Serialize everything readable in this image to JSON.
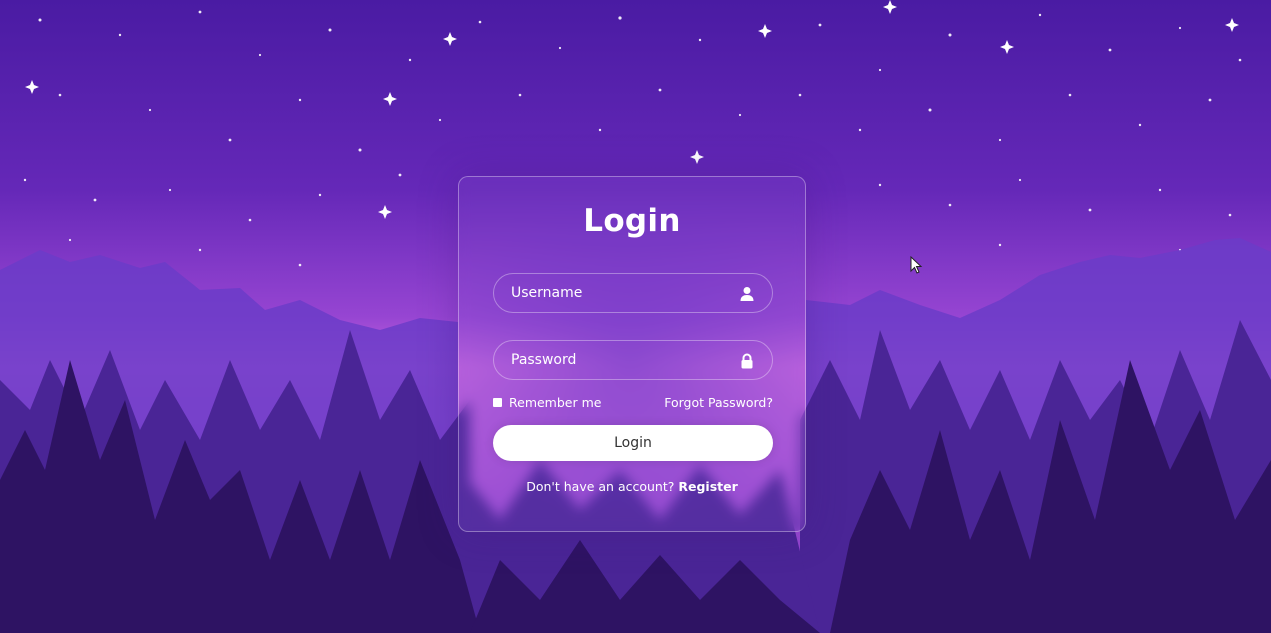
{
  "login_form": {
    "title": "Login",
    "username": {
      "placeholder": "Username",
      "value": "",
      "icon": "user-icon"
    },
    "password": {
      "placeholder": "Password",
      "value": "",
      "icon": "lock-icon"
    },
    "remember_label": "Remember me",
    "remember_checked": false,
    "forgot_label": "Forgot Password?",
    "submit_label": "Login",
    "register_prompt": "Don't have an account?",
    "register_label": "Register"
  },
  "colors": {
    "sky_top": "#4a1ba3",
    "sky_horizon": "#b05ad8",
    "trees_dark": "#2e1363",
    "button_bg": "#ffffff",
    "button_text": "#333333"
  }
}
